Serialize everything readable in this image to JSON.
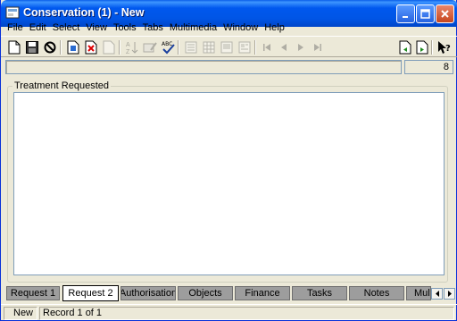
{
  "window": {
    "title": "Conservation (1) - New"
  },
  "menu": [
    "File",
    "Edit",
    "Select",
    "View",
    "Tools",
    "Tabs",
    "Multimedia",
    "Window",
    "Help"
  ],
  "record": {
    "count": "8"
  },
  "group": {
    "label": "Treatment Requested",
    "value": ""
  },
  "tabs": [
    "Request 1",
    "Request 2",
    "Authorisation",
    "Objects",
    "Finance",
    "Tasks",
    "Notes",
    "Multi"
  ],
  "active_tab": "Request 2",
  "status": {
    "mode": "New",
    "record": "Record 1 of 1"
  },
  "colors": {
    "titlebar": "#0055E5",
    "face": "#ECE9D8",
    "tab_inactive": "#9D9D9D",
    "tab_active": "#FFFFFF"
  }
}
